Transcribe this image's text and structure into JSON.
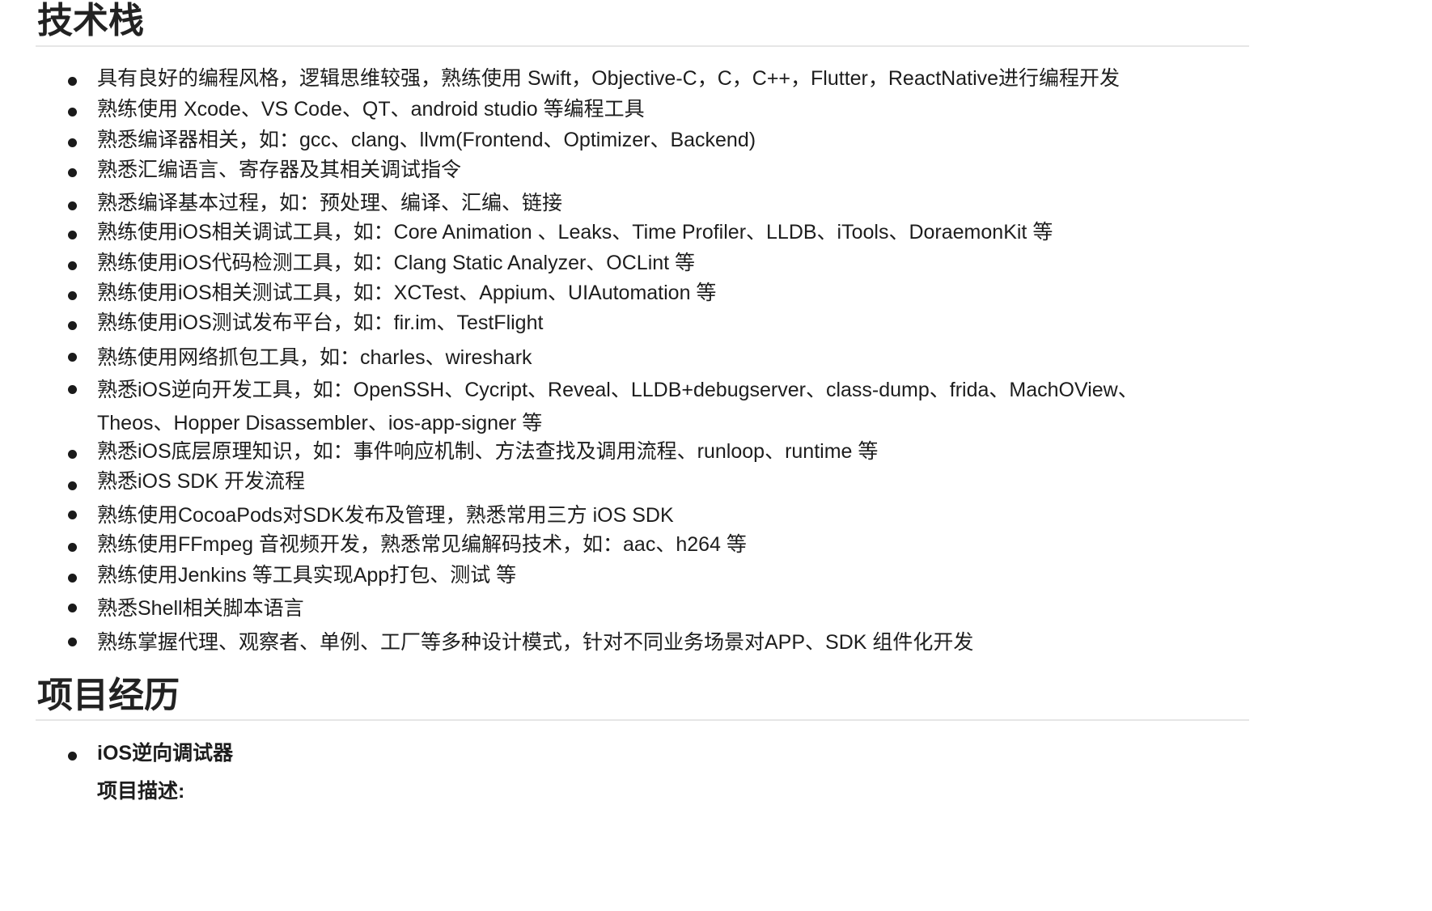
{
  "sections": {
    "tech": {
      "title": "技术栈",
      "items": [
        "具有良好的编程风格，逻辑思维较强，熟练使用 Swift，Objective-C，C，C++，Flutter，ReactNative进行编程开发",
        "熟练使用 Xcode、VS Code、QT、android studio 等编程工具",
        "熟悉编译器相关，如：gcc、clang、llvm(Frontend、Optimizer、Backend)",
        "熟悉汇编语言、寄存器及其相关调试指令",
        "熟悉编译基本过程，如：预处理、编译、汇编、链接",
        "熟练使用iOS相关调试工具，如：Core Animation 、Leaks、Time Profiler、LLDB、iTools、DoraemonKit 等",
        "熟练使用iOS代码检测工具，如：Clang Static Analyzer、OCLint 等",
        "熟练使用iOS相关测试工具，如：XCTest、Appium、UIAutomation 等",
        "熟练使用iOS测试发布平台，如：fir.im、TestFlight",
        "熟练使用网络抓包工具，如：charles、wireshark",
        "熟悉iOS逆向开发工具，如：OpenSSH、Cycript、Reveal、LLDB+debugserver、class-dump、frida、MachOView、Theos、Hopper Disassembler、ios-app-signer 等",
        "熟悉iOS底层原理知识，如：事件响应机制、方法查找及调用流程、runloop、runtime 等",
        "熟悉iOS SDK 开发流程",
        "熟练使用CocoaPods对SDK发布及管理，熟悉常用三方 iOS SDK",
        "熟练使用FFmpeg 音视频开发，熟悉常见编解码技术，如：aac、h264 等",
        "熟练使用Jenkins 等工具实现App打包、测试 等",
        "熟悉Shell相关脚本语言",
        "熟练掌握代理、观察者、单例、工厂等多种设计模式，针对不同业务场景对APP、SDK 组件化开发"
      ]
    },
    "projects": {
      "title": "项目经历",
      "item_title": "iOS逆向调试器",
      "item_sub": "项目描述:"
    }
  }
}
